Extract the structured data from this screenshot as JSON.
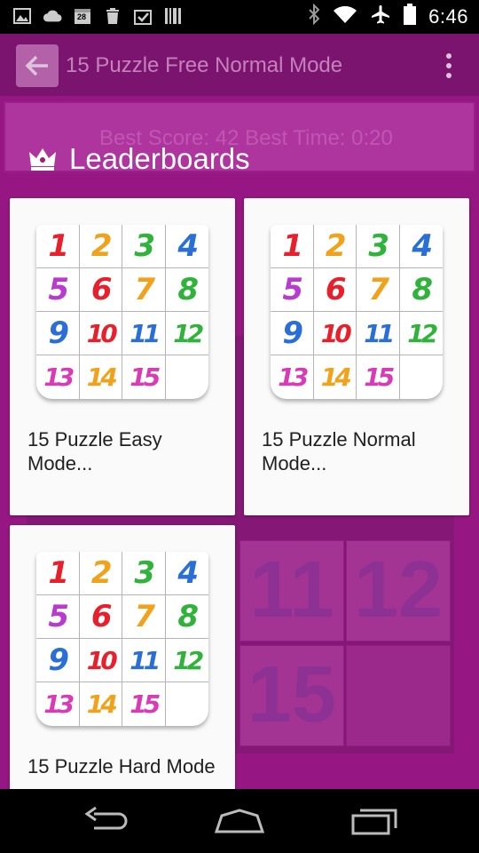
{
  "status_bar": {
    "left_icons": [
      "gallery-icon",
      "cloud-icon",
      "calendar-icon",
      "trash-icon",
      "clipboard-check-icon",
      "barcode-icon"
    ],
    "calendar_day": "28",
    "right_icons": [
      "bluetooth-icon",
      "wifi-icon",
      "airplane-mode-icon",
      "battery-icon"
    ],
    "time": "6:46"
  },
  "background_app": {
    "title": "15 Puzzle Free Normal Mode",
    "score_text": "Best Score: 42 Best Time: 0:20",
    "tiles": [
      "11",
      "12",
      "15"
    ],
    "accent_color": "#a0198c"
  },
  "dialog": {
    "title": "Leaderboards",
    "icon": "crown-icon",
    "cards": [
      {
        "label": "15 Puzzle Easy Mode..."
      },
      {
        "label": "15 Puzzle Normal Mode..."
      },
      {
        "label": "15 Puzzle Hard Mode"
      }
    ],
    "puzzle_numbers": [
      "1",
      "2",
      "3",
      "4",
      "5",
      "6",
      "7",
      "8",
      "9",
      "10",
      "11",
      "12",
      "13",
      "14",
      "15",
      ""
    ],
    "number_colors": [
      "#e8202c",
      "#f0a21a",
      "#2fb33b",
      "#2a6fd8",
      "#b93ad0",
      "#e8202c",
      "#f0a21a",
      "#2fb33b",
      "#2a6fd8",
      "#e8202c",
      "#2a6fd8",
      "#2fb33b",
      "#d83ab8",
      "#f0a21a",
      "#d83ab8",
      "#ffffff"
    ]
  },
  "nav_bar": {
    "buttons": [
      "back-icon",
      "home-icon",
      "recents-icon"
    ]
  }
}
